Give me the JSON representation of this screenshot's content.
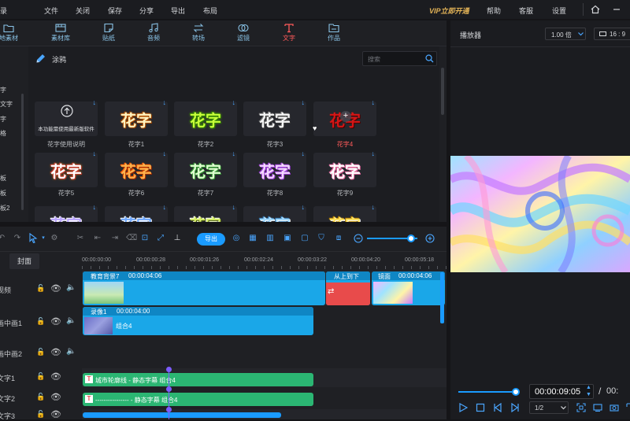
{
  "menubar": {
    "left_cut": "录",
    "items": [
      "文件",
      "关闭",
      "保存",
      "分享",
      "导出",
      "布局"
    ],
    "vip": "VIP立即开通",
    "right_items": [
      "帮助",
      "客服",
      "设置"
    ]
  },
  "category_tabs": [
    {
      "label": "地素材",
      "icon": "folder-icon"
    },
    {
      "label": "素材库",
      "icon": "film-icon"
    },
    {
      "label": "贴纸",
      "icon": "sticker-icon"
    },
    {
      "label": "音频",
      "icon": "music-icon"
    },
    {
      "label": "转场",
      "icon": "transition-icon"
    },
    {
      "label": "滤镜",
      "icon": "filter-icon"
    },
    {
      "label": "文字",
      "icon": "text-icon"
    },
    {
      "label": "作品",
      "icon": "works-icon"
    }
  ],
  "sidenav": [
    "字",
    "文字",
    "字",
    "格",
    "",
    "板",
    "板",
    "板2"
  ],
  "section": {
    "title": "涂鸦",
    "search_placeholder": "搜索"
  },
  "tiles": [
    {
      "label": "花字使用说明",
      "text": "本功能需使用最新版软件"
    },
    {
      "label": "花字1",
      "text": "花字"
    },
    {
      "label": "花字2",
      "text": "花字"
    },
    {
      "label": "花字3",
      "text": "花字"
    },
    {
      "label": "花字4",
      "text": "花字"
    },
    {
      "label": "花字5",
      "text": "花字"
    },
    {
      "label": "花字6",
      "text": "花字"
    },
    {
      "label": "花字7",
      "text": "花字"
    },
    {
      "label": "花字8",
      "text": "花字"
    },
    {
      "label": "花字9",
      "text": "花字"
    },
    {
      "label": "",
      "text": "花字"
    },
    {
      "label": "",
      "text": "花字"
    },
    {
      "label": "",
      "text": "花字"
    },
    {
      "label": "",
      "text": "花字"
    },
    {
      "label": "",
      "text": "花字"
    }
  ],
  "player": {
    "title": "播放器",
    "speed": "1.00 倍",
    "ratio": "16 : 9",
    "time": "00:00:09:05",
    "slash": "/",
    "total": "00:",
    "page": "1/2"
  },
  "timeline": {
    "export_label": "导出",
    "cover_label": "封面",
    "ruler": [
      "00:00:00:00",
      "00:00:00:28",
      "00:00:01:26",
      "00:00:02:24",
      "00:00:03:22",
      "00:00:04:20",
      "00:00:05:18"
    ],
    "tracks": [
      {
        "name": "视频"
      },
      {
        "name": "画中画1"
      },
      {
        "name": "画中画2"
      },
      {
        "name": "文字1"
      },
      {
        "name": "文字2"
      },
      {
        "name": "文字3"
      }
    ],
    "clips": {
      "video_main": {
        "name": "教育背景7",
        "time": "00:00:04:06"
      },
      "video_trans": {
        "name": "从上到下"
      },
      "video_third": {
        "name": "镜面",
        "time": "00:00:04:06"
      },
      "pip1": {
        "name": "录像1",
        "time": "00:00:04:00",
        "label": "组合4"
      },
      "text1": {
        "label": "城市轮廓线 - 静态字幕  组合4"
      },
      "text2": {
        "label": "---------------- - 静态字幕  组合4"
      }
    }
  },
  "colors": {
    "accent": "#1a9bff",
    "text_clip": "#2bb673",
    "video_clip": "#1aa7e8",
    "active_tab": "#ff5a5a"
  }
}
